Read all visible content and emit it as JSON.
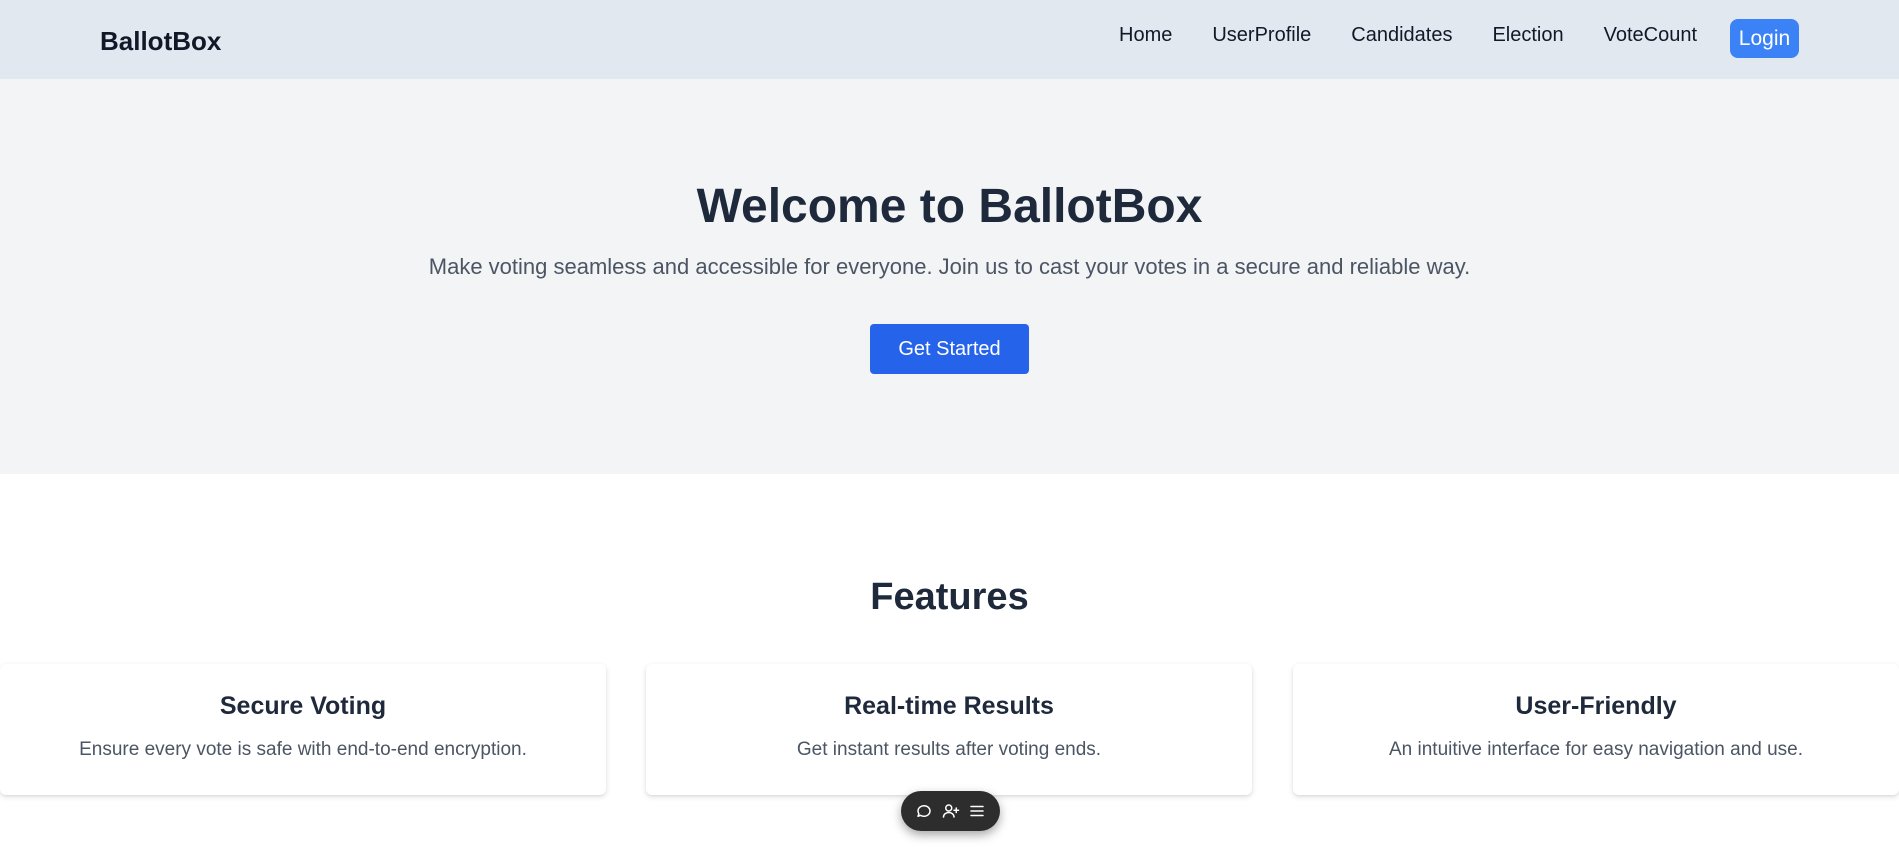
{
  "navbar": {
    "brand": "BallotBox",
    "links": [
      "Home",
      "UserProfile",
      "Candidates",
      "Election",
      "VoteCount"
    ],
    "login_label": "Login"
  },
  "hero": {
    "title": "Welcome to BallotBox",
    "subtitle": "Make voting seamless and accessible for everyone. Join us to cast your votes in a secure and reliable way.",
    "cta_label": "Get Started"
  },
  "features": {
    "title": "Features",
    "cards": [
      {
        "title": "Secure Voting",
        "description": "Ensure every vote is safe with end-to-end encryption."
      },
      {
        "title": "Real-time Results",
        "description": "Get instant results after voting ends."
      },
      {
        "title": "User-Friendly",
        "description": "An intuitive interface for easy navigation and use."
      }
    ]
  },
  "toolbar": {
    "icons": [
      "chat-icon",
      "add-user-icon",
      "menu-icon"
    ]
  },
  "colors": {
    "navbar_bg": "#e2e8f0",
    "hero_bg": "#f3f4f6",
    "login_btn": "#3b82f6",
    "cta_btn": "#2563eb",
    "heading": "#1e293b",
    "body_text": "#4b5563"
  }
}
